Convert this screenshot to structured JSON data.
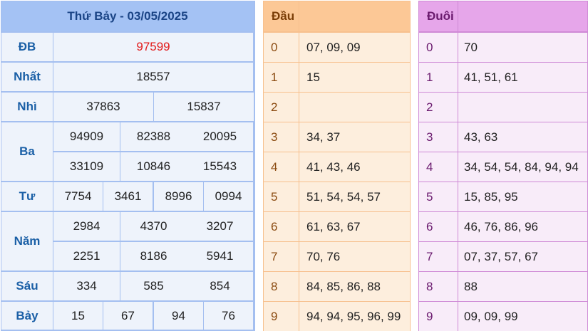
{
  "results": {
    "title": "Thứ Bảy - 03/05/2025",
    "rows": [
      {
        "label": "ĐB",
        "values": [
          "97599"
        ]
      },
      {
        "label": "Nhất",
        "values": [
          "18557"
        ]
      },
      {
        "label": "Nhì",
        "values": [
          "37863",
          "15837"
        ]
      },
      {
        "label": "Ba",
        "values": [
          "94909",
          "82388",
          "20095",
          "33109",
          "10846",
          "15543"
        ]
      },
      {
        "label": "Tư",
        "values": [
          "7754",
          "3461",
          "8996",
          "0994"
        ]
      },
      {
        "label": "Năm",
        "values": [
          "2984",
          "4370",
          "3207",
          "2251",
          "8186",
          "5941"
        ]
      },
      {
        "label": "Sáu",
        "values": [
          "334",
          "585",
          "854"
        ]
      },
      {
        "label": "Bảy",
        "values": [
          "15",
          "67",
          "94",
          "76"
        ]
      }
    ]
  },
  "dau": {
    "title": "Đầu",
    "rows": [
      {
        "digit": "0",
        "values": "07, 09, 09"
      },
      {
        "digit": "1",
        "values": "15"
      },
      {
        "digit": "2",
        "values": ""
      },
      {
        "digit": "3",
        "values": "34, 37"
      },
      {
        "digit": "4",
        "values": "41, 43, 46"
      },
      {
        "digit": "5",
        "values": "51, 54, 54, 57"
      },
      {
        "digit": "6",
        "values": "61, 63, 67"
      },
      {
        "digit": "7",
        "values": "70, 76"
      },
      {
        "digit": "8",
        "values": "84, 85, 86, 88"
      },
      {
        "digit": "9",
        "values": "94, 94, 95, 96, 99"
      }
    ]
  },
  "duoi": {
    "title": "Đuôi",
    "rows": [
      {
        "digit": "0",
        "values": "70"
      },
      {
        "digit": "1",
        "values": "41, 51, 61"
      },
      {
        "digit": "2",
        "values": ""
      },
      {
        "digit": "3",
        "values": "43, 63"
      },
      {
        "digit": "4",
        "values": "34, 54, 54, 84, 94, 94"
      },
      {
        "digit": "5",
        "values": "15, 85, 95"
      },
      {
        "digit": "6",
        "values": "46, 76, 86, 96"
      },
      {
        "digit": "7",
        "values": "07, 37, 57, 67"
      },
      {
        "digit": "8",
        "values": "88"
      },
      {
        "digit": "9",
        "values": "09, 09, 99"
      }
    ]
  },
  "colors": {
    "results_header": "#a4c2f4",
    "special_prize": "#e21a1a",
    "dau_header": "#fcc896",
    "duoi_header": "#e6a6ea"
  }
}
